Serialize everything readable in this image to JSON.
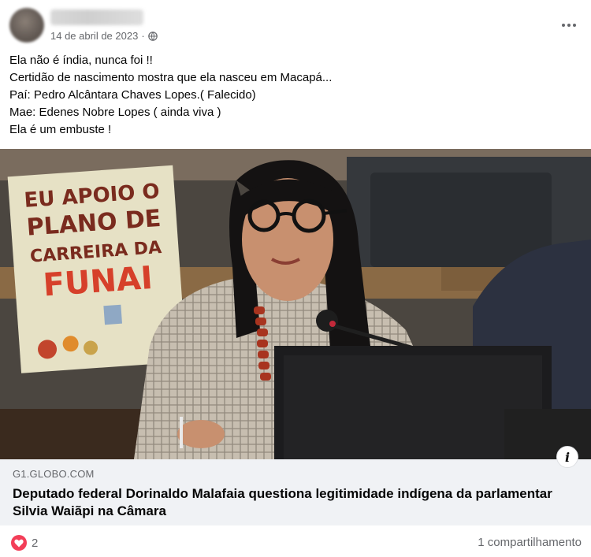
{
  "post": {
    "date": "14 de abril de 2023",
    "separator": "·",
    "privacy_icon": "globe-icon",
    "text_lines": [
      "Ela não é índia, nunca foi !!",
      "Certidão de nascimento mostra que ela nasceu em Macapá...",
      "Paí: Pedro Alcântara Chaves Lopes.( Falecido)",
      "Mae: Edenes Nobre Lopes ( ainda viva )",
      "Ela é um embuste !"
    ]
  },
  "photo": {
    "sign_lines": [
      "EU APOIO O",
      "PLANO DE",
      "CARREIRA DA",
      "FUNAI"
    ]
  },
  "link": {
    "domain": "G1.GLOBO.COM",
    "title": "Deputado federal Dorinaldo Malafaia questiona legitimidade indígena da parlamentar Silvia Waiãpi na Câmara"
  },
  "footer": {
    "reaction_count": "2",
    "share_text": "1 compartilhamento"
  },
  "colors": {
    "accent_reaction": "#f33e58",
    "card_bg": "#f0f2f5",
    "muted_text": "#65676b"
  }
}
